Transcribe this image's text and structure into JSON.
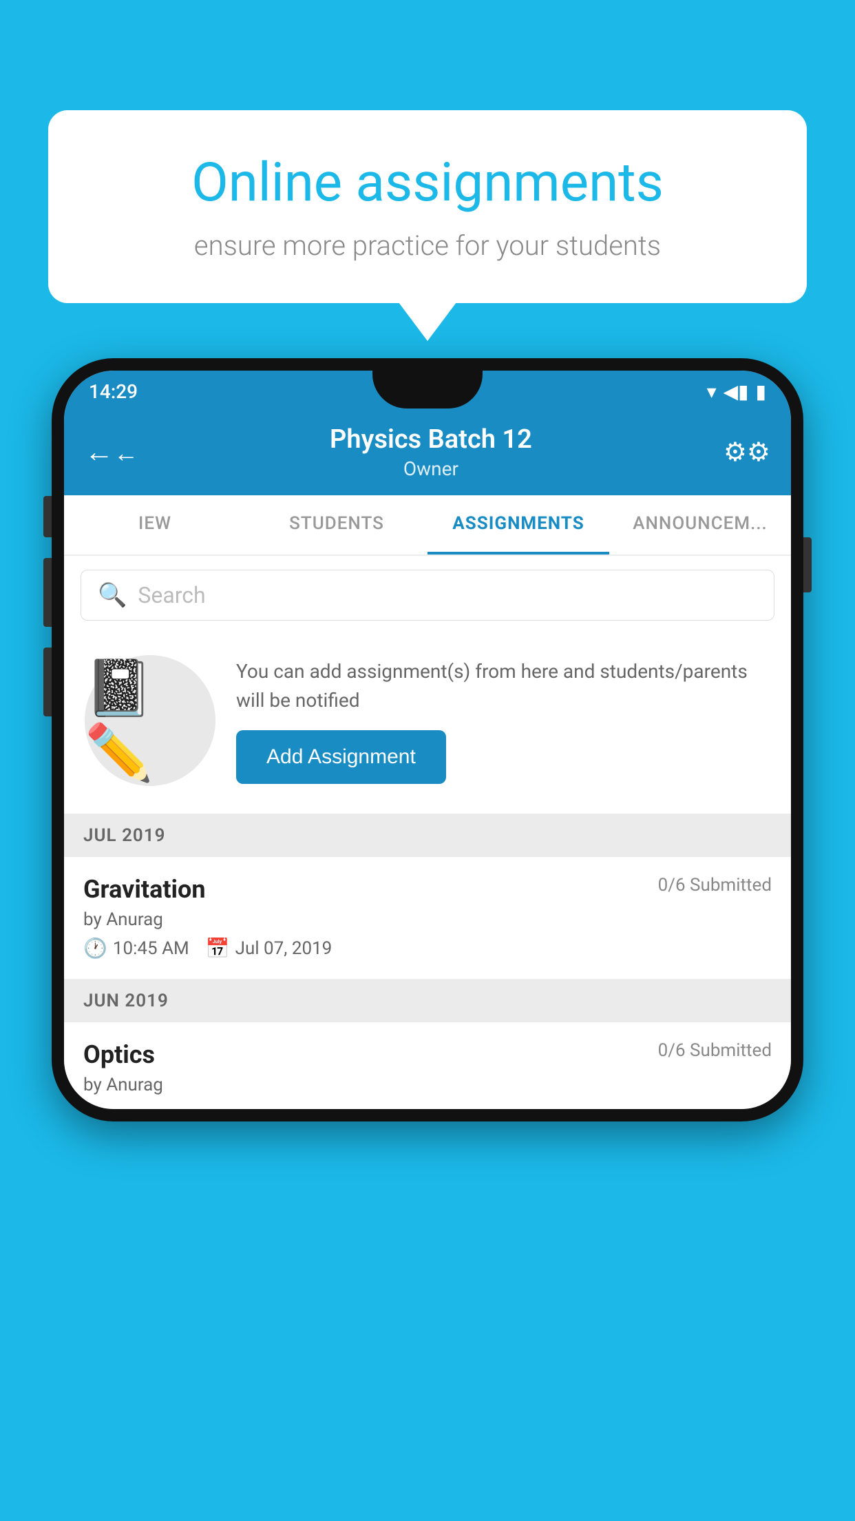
{
  "background_color": "#1bb8e8",
  "bubble": {
    "title": "Online assignments",
    "subtitle": "ensure more practice for your students"
  },
  "phone": {
    "status_bar": {
      "time": "14:29",
      "wifi_icon": "wifi",
      "signal_icon": "signal",
      "battery_icon": "battery"
    },
    "header": {
      "title": "Physics Batch 12",
      "subtitle": "Owner",
      "back_label": "←",
      "settings_label": "⚙"
    },
    "tabs": [
      {
        "label": "IEW",
        "active": false
      },
      {
        "label": "STUDENTS",
        "active": false
      },
      {
        "label": "ASSIGNMENTS",
        "active": true
      },
      {
        "label": "ANNOUNCEM...",
        "active": false
      }
    ],
    "search": {
      "placeholder": "Search"
    },
    "empty_state": {
      "description": "You can add assignment(s) from here and students/parents will be notified",
      "add_button_label": "Add Assignment"
    },
    "sections": [
      {
        "label": "JUL 2019",
        "assignments": [
          {
            "name": "Gravitation",
            "submitted": "0/6 Submitted",
            "by": "by Anurag",
            "time": "10:45 AM",
            "date": "Jul 07, 2019"
          }
        ]
      },
      {
        "label": "JUN 2019",
        "assignments": [
          {
            "name": "Optics",
            "submitted": "0/6 Submitted",
            "by": "by Anurag",
            "time": "",
            "date": ""
          }
        ]
      }
    ]
  }
}
